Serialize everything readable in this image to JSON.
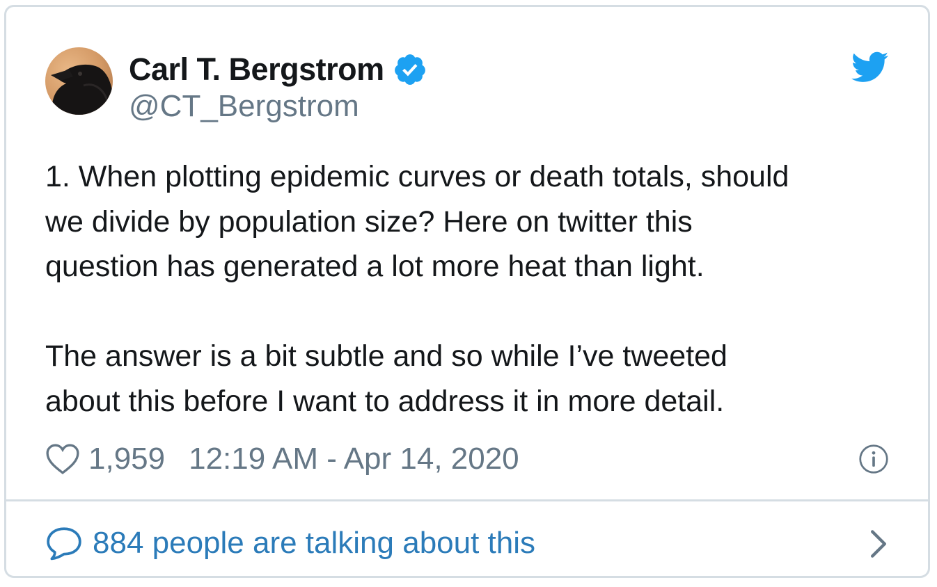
{
  "author": {
    "display_name": "Carl T. Bergstrom",
    "handle": "@CT_Bergstrom",
    "verified": true,
    "avatar_icon": "crow-avatar"
  },
  "tweet": {
    "lines_p1": [
      "1. When plotting epidemic curves or death totals, should",
      "we divide by population size? Here on twitter this",
      "question has generated a lot more heat than light."
    ],
    "lines_p2": [
      "The answer is a bit subtle and so while I’ve tweeted",
      "about this before I want to address it in more detail."
    ]
  },
  "meta": {
    "likes": "1,959",
    "timestamp": "12:19 AM - Apr 14, 2020"
  },
  "footer": {
    "talking_label": "884 people are talking about this"
  },
  "icons": {
    "brand": "twitter-bird-icon",
    "like": "heart-icon",
    "info": "info-icon",
    "reply": "speech-bubble-icon",
    "more": "chevron-right-icon"
  },
  "colors": {
    "text": "#14171a",
    "secondary": "#657786",
    "link": "#2b7bb9",
    "verified": "#1da1f2",
    "twitter_blue": "#1da1f2",
    "border": "#d5dde3"
  }
}
